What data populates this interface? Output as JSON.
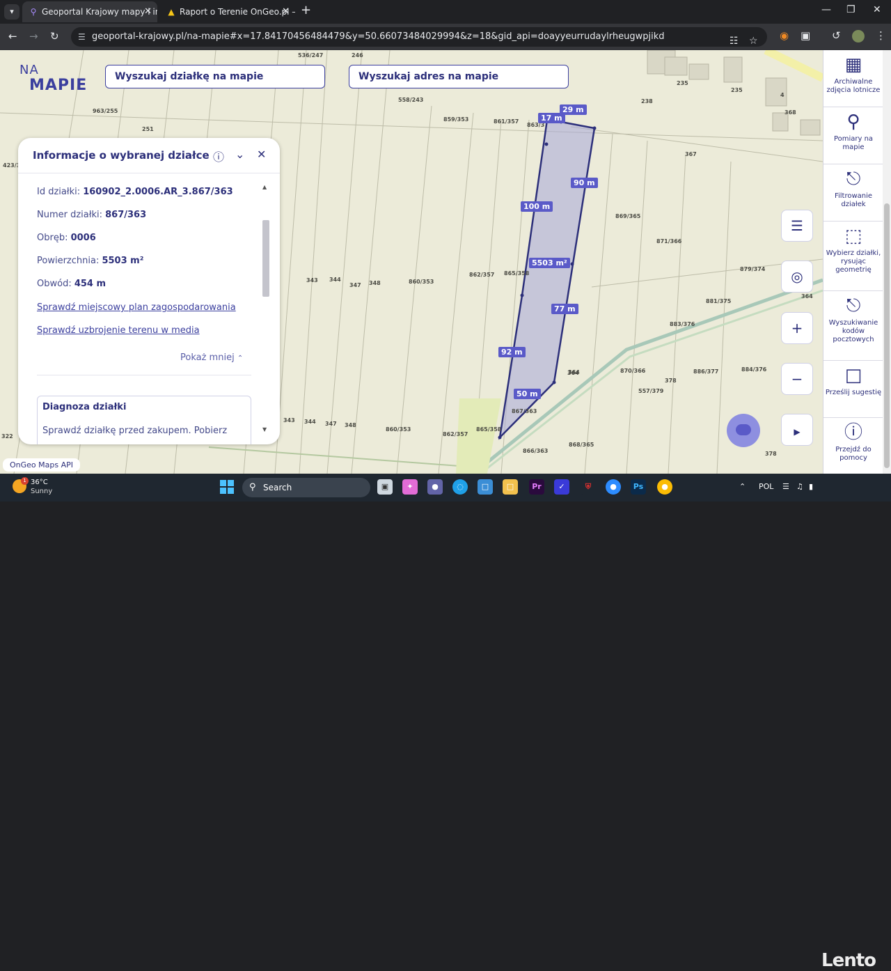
{
  "browser": {
    "tabs": [
      {
        "title": "Geoportal Krajowy mapy i infor",
        "active": true
      },
      {
        "title": "Raport o Terenie OnGeo.pl – Ar",
        "active": false
      }
    ],
    "url": "geoportal-krajowy.pl/na-mapie#x=17.84170456484479&y=50.66073484029994&z=18&gid_api=doayyeurrudaylrheugwpjikd"
  },
  "header": {
    "logo_top": "NA",
    "logo_bottom": "MAPIE",
    "search_parcel": "Wyszukaj działkę na mapie",
    "search_address": "Wyszukaj adres na mapie"
  },
  "info_panel": {
    "title": "Informacje o wybranej działce",
    "rows": [
      {
        "label": "Id działki: ",
        "value": "160902_2.0006.AR_3.867/363"
      },
      {
        "label": "Numer działki: ",
        "value": "867/363"
      },
      {
        "label": "Obręb: ",
        "value": "0006"
      },
      {
        "label": "Powierzchnia: ",
        "value": "5503 m²"
      },
      {
        "label": "Obwód: ",
        "value": "454 m"
      }
    ],
    "links": [
      "Sprawdź miejscowy plan zagospodarowania",
      "Sprawdź uzbrojenie terenu w media"
    ],
    "toggle_less": "Pokaż mniej",
    "diagnosis_title": "Diagnoza działki",
    "diagnosis_text": "Sprawdź działkę przed zakupem. Pobierz"
  },
  "map": {
    "measurements": [
      "17 m",
      "29 m",
      "90 m",
      "100 m",
      "5503 m²",
      "77 m",
      "92 m",
      "50 m"
    ],
    "parcel_labels": [
      "536/247",
      "246",
      "963/255",
      "251",
      "423/3",
      "558/243",
      "859/353",
      "861/357",
      "863/3",
      "238",
      "235",
      "235",
      "4",
      "368",
      "367",
      "869/365",
      "871/366",
      "879/374",
      "881/375",
      "883/376",
      "886/377",
      "884/376",
      "870/366",
      "557/379",
      "378",
      "364",
      "343",
      "344",
      "347",
      "348",
      "860/353",
      "862/357",
      "865/358",
      "343",
      "344",
      "347",
      "348",
      "860/353",
      "862/357",
      "865/358",
      "867/363",
      "866/363",
      "868/365",
      "364",
      "322",
      "378",
      "364"
    ],
    "api_label": "OnGeo Maps API"
  },
  "sidebar": [
    {
      "label": "Archiwalne zdjęcia lotnicze",
      "icon": "photo-stack-icon"
    },
    {
      "label": "Pomiary na mapie",
      "icon": "measure-route-icon"
    },
    {
      "label": "Filtrowanie działek",
      "icon": "map-search-icon"
    },
    {
      "label": "Wybierz działki, rysując geometrię",
      "icon": "select-area-icon"
    },
    {
      "label": "Wyszukiwanie kodów pocztowych",
      "icon": "map-search-icon"
    },
    {
      "label": "Prześlij sugestię",
      "icon": "chat-icon"
    },
    {
      "label": "Przejdź do pomocy",
      "icon": "help-icon"
    }
  ],
  "taskbar": {
    "temp": "36°C",
    "weather": "Sunny",
    "weather_badge": "1",
    "search": "Search",
    "lang": "POL",
    "watermark": "Lento"
  },
  "colors": {
    "accent": "#5a5ac8",
    "brand": "#2c2f7a"
  }
}
